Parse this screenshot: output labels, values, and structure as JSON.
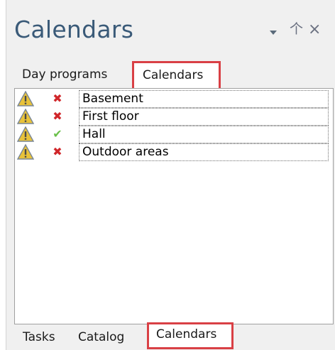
{
  "panel": {
    "title": "Calendars",
    "buttons": {
      "dropdown_icon": "chevron-down-icon",
      "pin_glyph": "个",
      "close_glyph": "×"
    }
  },
  "top_tabs": [
    {
      "label": "Day programs",
      "selected": false
    },
    {
      "label": "Calendars",
      "selected": true
    }
  ],
  "calendars": [
    {
      "name": "Basement",
      "warning": true,
      "status": "error",
      "status_glyph": "✖"
    },
    {
      "name": "First floor",
      "warning": true,
      "status": "error",
      "status_glyph": "✖"
    },
    {
      "name": "Hall",
      "warning": true,
      "status": "ok",
      "status_glyph": "✔"
    },
    {
      "name": "Outdoor areas",
      "warning": true,
      "status": "error",
      "status_glyph": "✖"
    }
  ],
  "bottom_tabs": [
    {
      "label": "Tasks",
      "selected": false
    },
    {
      "label": "Catalog",
      "selected": false
    },
    {
      "label": "Calendars",
      "selected": true
    }
  ],
  "colors": {
    "title": "#3a5a78",
    "highlight": "#d94045",
    "error": "#d0262a",
    "ok": "#6ac04a",
    "warning_fill": "#e8c23a"
  }
}
